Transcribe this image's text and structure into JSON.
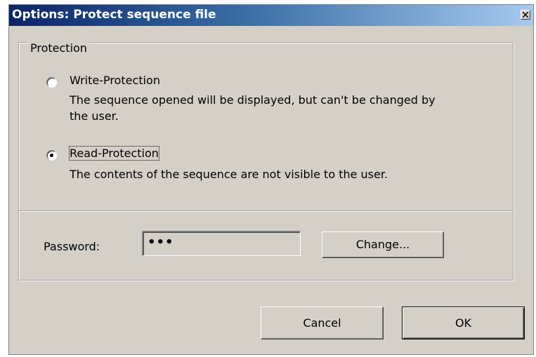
{
  "dialog": {
    "title": "Options: Protect sequence file",
    "close_icon": "close-icon"
  },
  "protection": {
    "group_label": "Protection",
    "options": [
      {
        "label": "Write-Protection",
        "description_line1": "The sequence opened will be displayed, but can't be changed by",
        "description_line2": "the user.",
        "selected": false
      },
      {
        "label": "Read-Protection",
        "description_line1": "The contents of the sequence are not visible to the user.",
        "selected": true
      }
    ]
  },
  "password": {
    "label": "Password:",
    "value": "•••",
    "change_button": "Change..."
  },
  "buttons": {
    "cancel": "Cancel",
    "ok": "OK"
  },
  "colors": {
    "title_start": "#0a246a",
    "title_end": "#a6caf0",
    "dialog_bg": "#d4d0c8"
  }
}
